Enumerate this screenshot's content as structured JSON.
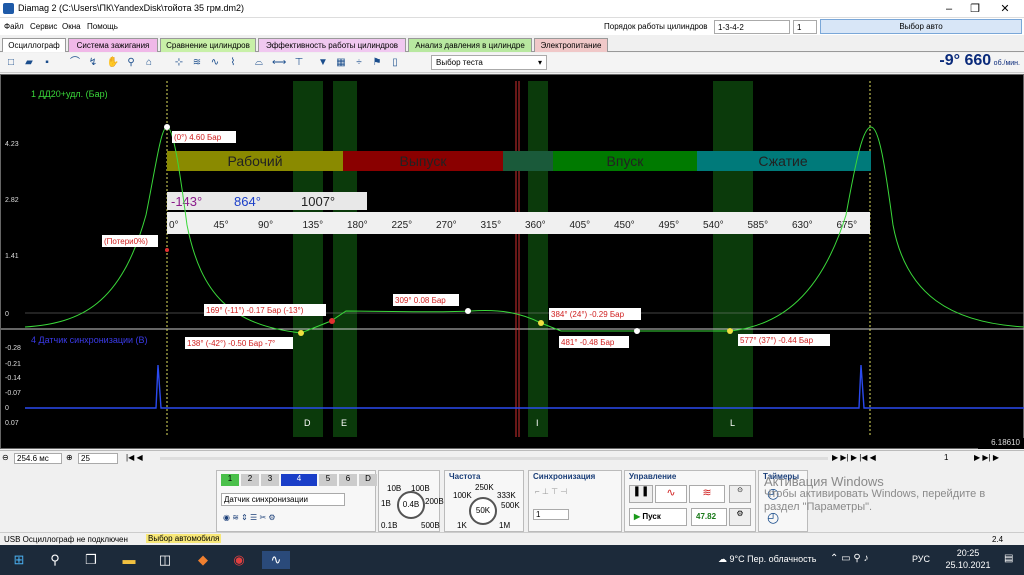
{
  "window": {
    "title": "Diamag 2 (C:\\Users\\ПК\\YandexDisk\\тойота 35 грм.dm2)"
  },
  "menu": [
    "Файл",
    "Сервис",
    "Окна",
    "Помощь"
  ],
  "cylinder": {
    "label": "Порядок работы цилиндров",
    "order": "1-3-4-2",
    "num": "1"
  },
  "auto_button": "Выбор авто",
  "tabs": [
    {
      "label": "Осциллограф",
      "color": "#ffffff"
    },
    {
      "label": "Система зажигания",
      "color": "#f0b8e8"
    },
    {
      "label": "Сравнение цилиндров",
      "color": "#c8f0a8"
    },
    {
      "label": "Эффективность работы цилиндров",
      "color": "#f0c8f0"
    },
    {
      "label": "Анализ давления в цилиндре",
      "color": "#b8e8a0"
    },
    {
      "label": "Электропитание",
      "color": "#f0c8c8"
    }
  ],
  "test_select": "Выбор теста",
  "rpm": {
    "value": "-9° 660",
    "unit": "об./мин."
  },
  "scope": {
    "ch1_label": "1 ДД20+удл. (Бар)",
    "ch2_label": "4 Датчик синхронизации (В)",
    "y1_ticks": [
      "4.23",
      "2.82",
      "1.41",
      "0",
      "-0.28"
    ],
    "y2_ticks": [
      "-0.28",
      "-0.21",
      "-0.14",
      "-0.07",
      "0",
      "0.07"
    ],
    "phases": [
      {
        "label": "Рабочий",
        "color": "#8a8a00"
      },
      {
        "label": "Выпуск",
        "color": "#8a0000"
      },
      {
        "label": "Впуск",
        "color": "#007a00"
      },
      {
        "label": "Сжатие",
        "color": "#007a7a"
      }
    ],
    "cursor_a": "-143°",
    "cursor_b": "864°",
    "delta": "1007°",
    "degree_ticks": [
      "0°",
      "45°",
      "90°",
      "135°",
      "180°",
      "225°",
      "270°",
      "315°",
      "360°",
      "405°",
      "450°",
      "495°",
      "540°",
      "585°",
      "630°",
      "675°"
    ],
    "annotations": [
      "(0°) 4.60 Бар",
      "(Потери0%)",
      "169° (-11°) -0.17 Бар (-13°)",
      "309° 0.08 Бар",
      "384° (24°) -0.29 Бар",
      "138° (-42°) -0.50 Бар -7°",
      "481° -0.48 Бар",
      "577° (37°) -0.44 Бар"
    ],
    "markers": [
      "D",
      "E",
      "I",
      "L"
    ],
    "bottom_value": "6.18610"
  },
  "bottom": {
    "time": "254.6 мс",
    "zoom": "25",
    "page": "1"
  },
  "channels": [
    "1",
    "2",
    "3",
    "4",
    "5",
    "6",
    "D"
  ],
  "sensor_select": "Датчик синхронизации",
  "volt": {
    "center": "0.4В",
    "labels": [
      "10В",
      "100В",
      "1В",
      "200В",
      "0.1В",
      "500В"
    ]
  },
  "freq": {
    "title": "Частота",
    "center": "50K",
    "labels": [
      "250K",
      "100K",
      "333K",
      "500K",
      "1K",
      "1M"
    ]
  },
  "sync": {
    "title": "Синхронизация",
    "value": "1"
  },
  "control": {
    "title": "Управление",
    "start": "Пуск",
    "value": "47.82"
  },
  "timers": {
    "title": "Таймеры"
  },
  "watermark": [
    "Активация Windows",
    "Чтобы активировать Windows, перейдите в",
    "раздел \"Параметры\"."
  ],
  "status": {
    "usb": "USB Осциллограф не подключен",
    "car": "Выбор автомобиля",
    "right": "2.4"
  },
  "taskbar": {
    "weather": "9°C  Пер. облачность",
    "lang": "РУС",
    "time": "20:25",
    "date": "25.10.2021"
  }
}
